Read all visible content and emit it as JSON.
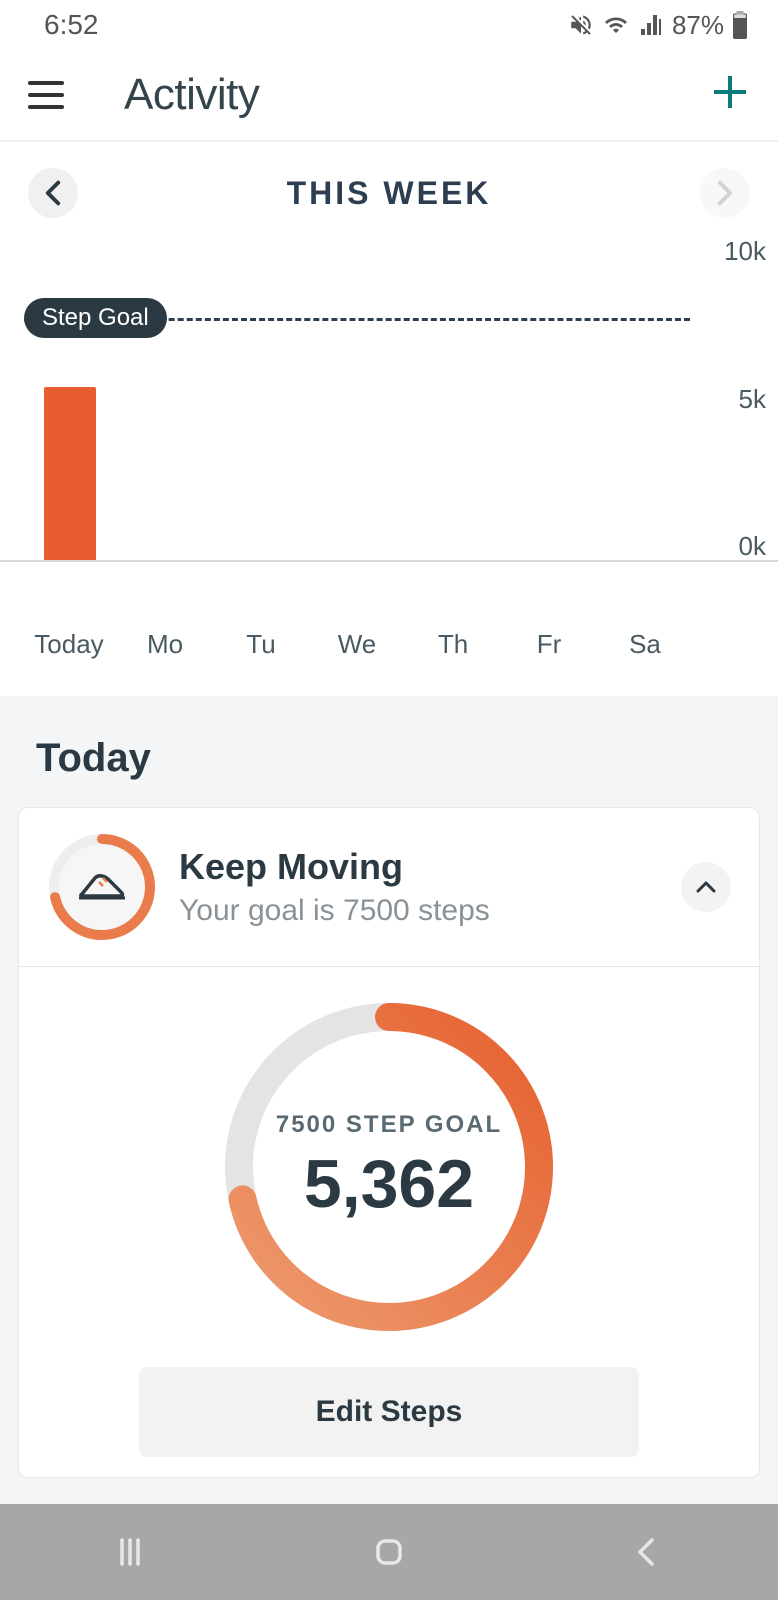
{
  "status_bar": {
    "time": "6:52",
    "battery_pct": "87%"
  },
  "app_bar": {
    "title": "Activity"
  },
  "week": {
    "label": "THIS WEEK"
  },
  "chart_data": {
    "type": "bar",
    "categories": [
      "Today",
      "Mo",
      "Tu",
      "We",
      "Th",
      "Fr",
      "Sa"
    ],
    "values": [
      5362,
      0,
      0,
      0,
      0,
      0,
      0
    ],
    "goal": 7500,
    "goal_label": "Step Goal",
    "ylim": [
      0,
      10000
    ],
    "y_ticks": [
      "10k",
      "5k",
      "0k"
    ]
  },
  "today": {
    "heading": "Today",
    "card": {
      "title": "Keep Moving",
      "subtitle": "Your goal is 7500 steps",
      "goal_label": "7500 STEP GOAL",
      "steps_display": "5,362",
      "edit_label": "Edit Steps",
      "progress_fraction": 0.715
    }
  }
}
